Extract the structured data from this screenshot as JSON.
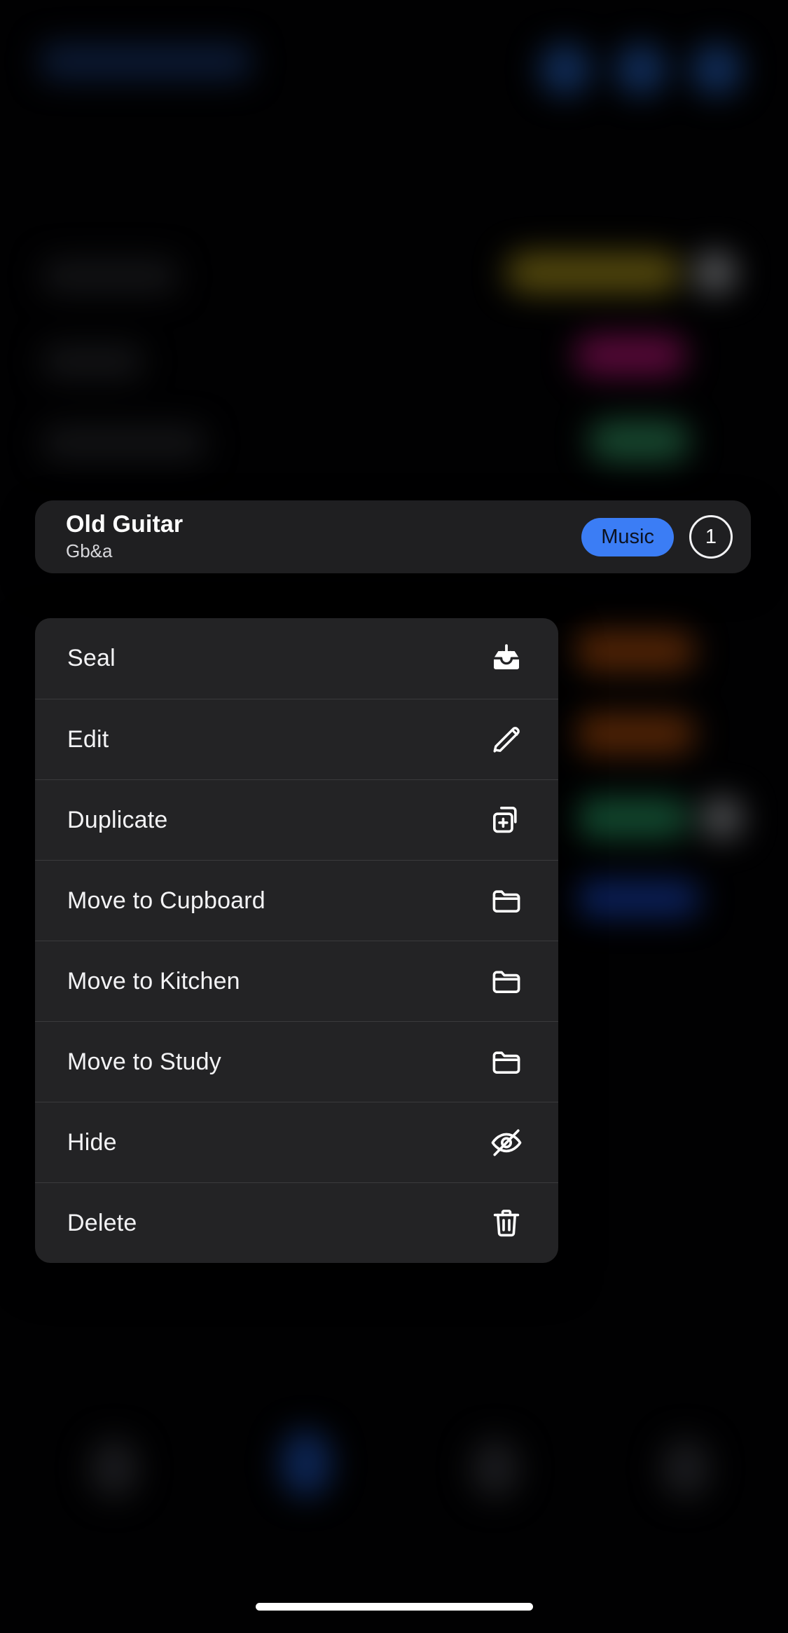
{
  "card": {
    "title": "Old Guitar",
    "subtitle": "Gb&a",
    "tag_label": "Music",
    "count": "1",
    "tag_color": "#3b7df5",
    "background": "#1f1f21"
  },
  "context_menu": {
    "items": [
      {
        "label": "Seal",
        "icon": "archive-down-icon"
      },
      {
        "label": "Edit",
        "icon": "pencil-icon"
      },
      {
        "label": "Duplicate",
        "icon": "duplicate-plus-icon"
      },
      {
        "label": "Move to Cupboard",
        "icon": "folder-icon"
      },
      {
        "label": "Move to Kitchen",
        "icon": "folder-icon"
      },
      {
        "label": "Move to Study",
        "icon": "folder-icon"
      },
      {
        "label": "Hide",
        "icon": "eye-slash-icon"
      },
      {
        "label": "Delete",
        "icon": "trash-icon"
      }
    ]
  },
  "background": {
    "header_title_color": "#1b3a74",
    "header_action_color": "#2563c4",
    "tags": [
      {
        "name": "yellow-tag",
        "color": "#b8a01e"
      },
      {
        "name": "white-chip-1",
        "color": "#b9bcc2"
      },
      {
        "name": "magenta-tag",
        "color": "#c4157f"
      },
      {
        "name": "green-tag-1",
        "color": "#35a06a"
      },
      {
        "name": "orange-tag-1",
        "color": "#b5500f"
      },
      {
        "name": "orange-tag-2",
        "color": "#b5500f"
      },
      {
        "name": "green-tag-2",
        "color": "#2aa269"
      },
      {
        "name": "white-chip-2",
        "color": "#a9acb2"
      },
      {
        "name": "blue-tag",
        "color": "#1a49c9"
      }
    ],
    "list_row_color": "#2b2c31",
    "tabbar_active_color": "#1d52b8",
    "tabbar_inactive_color": "#3a3b42",
    "home_indicator_color": "#ffffff"
  }
}
